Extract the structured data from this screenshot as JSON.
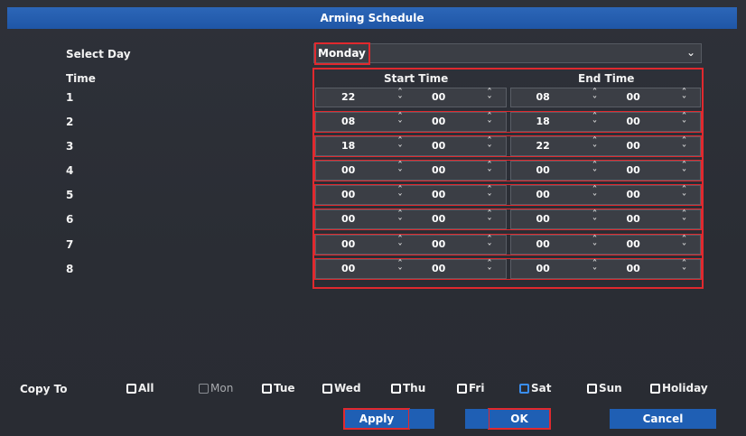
{
  "window": {
    "title": "Arming Schedule"
  },
  "select_day": {
    "label": "Select Day",
    "value": "Monday"
  },
  "time_label": "Time",
  "columns": {
    "start": "Start Time",
    "end": "End Time"
  },
  "rows": [
    {
      "index": "1",
      "start_h": "22",
      "start_m": "00",
      "end_h": "08",
      "end_m": "00"
    },
    {
      "index": "2",
      "start_h": "08",
      "start_m": "00",
      "end_h": "18",
      "end_m": "00"
    },
    {
      "index": "3",
      "start_h": "18",
      "start_m": "00",
      "end_h": "22",
      "end_m": "00"
    },
    {
      "index": "4",
      "start_h": "00",
      "start_m": "00",
      "end_h": "00",
      "end_m": "00"
    },
    {
      "index": "5",
      "start_h": "00",
      "start_m": "00",
      "end_h": "00",
      "end_m": "00"
    },
    {
      "index": "6",
      "start_h": "00",
      "start_m": "00",
      "end_h": "00",
      "end_m": "00"
    },
    {
      "index": "7",
      "start_h": "00",
      "start_m": "00",
      "end_h": "00",
      "end_m": "00"
    },
    {
      "index": "8",
      "start_h": "00",
      "start_m": "00",
      "end_h": "00",
      "end_m": "00"
    }
  ],
  "copy_to": {
    "label": "Copy To",
    "options": [
      {
        "label": "All",
        "checked": false,
        "enabled": true
      },
      {
        "label": "Mon",
        "checked": false,
        "enabled": false
      },
      {
        "label": "Tue",
        "checked": false,
        "enabled": true
      },
      {
        "label": "Wed",
        "checked": false,
        "enabled": true
      },
      {
        "label": "Thu",
        "checked": false,
        "enabled": true
      },
      {
        "label": "Fri",
        "checked": false,
        "enabled": true
      },
      {
        "label": "Sat",
        "checked": false,
        "enabled": true,
        "focused": true
      },
      {
        "label": "Sun",
        "checked": false,
        "enabled": true
      },
      {
        "label": "Holiday",
        "checked": false,
        "enabled": true
      }
    ]
  },
  "buttons": {
    "apply": "Apply",
    "ok": "OK",
    "cancel": "Cancel"
  },
  "colors": {
    "accent": "#1f5fb4",
    "highlight": "#e0292e",
    "background": "#2a2d35",
    "field": "#3b3e45"
  },
  "icons": {
    "dropdown": "chevron-down-icon",
    "spinner": "up-down-spinner-icon"
  }
}
